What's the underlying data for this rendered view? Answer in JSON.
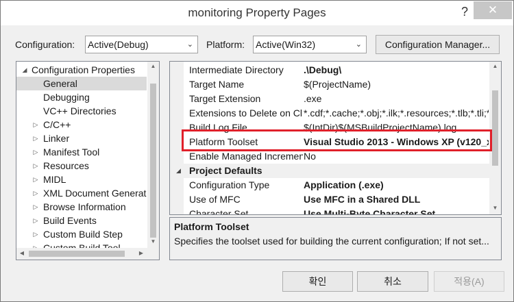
{
  "window": {
    "title": "monitoring Property Pages",
    "help_glyph": "?",
    "close_glyph": "✕"
  },
  "config_bar": {
    "configuration_label": "Configuration:",
    "configuration_value": "Active(Debug)",
    "platform_label": "Platform:",
    "platform_value": "Active(Win32)",
    "manager_button": "Configuration Manager..."
  },
  "tree": {
    "items": [
      {
        "label": "Configuration Properties",
        "expander": "◢",
        "level": 0
      },
      {
        "label": "General",
        "expander": "",
        "level": 1,
        "selected": true
      },
      {
        "label": "Debugging",
        "expander": "",
        "level": 1
      },
      {
        "label": "VC++ Directories",
        "expander": "",
        "level": 1
      },
      {
        "label": "C/C++",
        "expander": "▷",
        "level": 1
      },
      {
        "label": "Linker",
        "expander": "▷",
        "level": 1
      },
      {
        "label": "Manifest Tool",
        "expander": "▷",
        "level": 1
      },
      {
        "label": "Resources",
        "expander": "▷",
        "level": 1
      },
      {
        "label": "MIDL",
        "expander": "▷",
        "level": 1
      },
      {
        "label": "XML Document Generat",
        "expander": "▷",
        "level": 1
      },
      {
        "label": "Browse Information",
        "expander": "▷",
        "level": 1
      },
      {
        "label": "Build Events",
        "expander": "▷",
        "level": 1
      },
      {
        "label": "Custom Build Step",
        "expander": "▷",
        "level": 1
      },
      {
        "label": "Custom Build Tool",
        "expander": "▷",
        "level": 1
      }
    ]
  },
  "properties": {
    "rows": [
      {
        "name": "Intermediate Directory",
        "value": ".\\Debug\\",
        "bold": true
      },
      {
        "name": "Target Name",
        "value": "$(ProjectName)",
        "bold": false
      },
      {
        "name": "Target Extension",
        "value": ".exe",
        "bold": false
      },
      {
        "name": "Extensions to Delete on Cl",
        "value": "*.cdf;*.cache;*.obj;*.ilk;*.resources;*.tlb;*.tli;*.tl",
        "bold": false
      },
      {
        "name": "Build Log File",
        "value": "$(IntDir)$(MSBuildProjectName).log",
        "bold": false
      },
      {
        "name": "Platform Toolset",
        "value": "Visual Studio 2013 - Windows XP (v120_x",
        "bold": true
      },
      {
        "name": "Enable Managed Incremen",
        "value": "No",
        "bold": false
      }
    ],
    "category": {
      "label": "Project Defaults",
      "expander": "◢"
    },
    "rows2": [
      {
        "name": "Configuration Type",
        "value": "Application (.exe)",
        "bold": true
      },
      {
        "name": "Use of MFC",
        "value": "Use MFC in a Shared DLL",
        "bold": true
      },
      {
        "name": "Character Set",
        "value": "Use Multi-Byte Character Set",
        "bold": true
      }
    ]
  },
  "description": {
    "title": "Platform Toolset",
    "text": "Specifies the toolset used for building the current configuration; If not set..."
  },
  "buttons": {
    "ok": "확인",
    "cancel": "취소",
    "apply": "적용(A)"
  },
  "icons": {
    "dropdown": "chevron-down-icon",
    "expanded": "expanded-triangle-icon",
    "collapsed": "collapsed-triangle-icon"
  },
  "colors": {
    "highlight_border": "#e0202a",
    "selection": "#dadada"
  }
}
